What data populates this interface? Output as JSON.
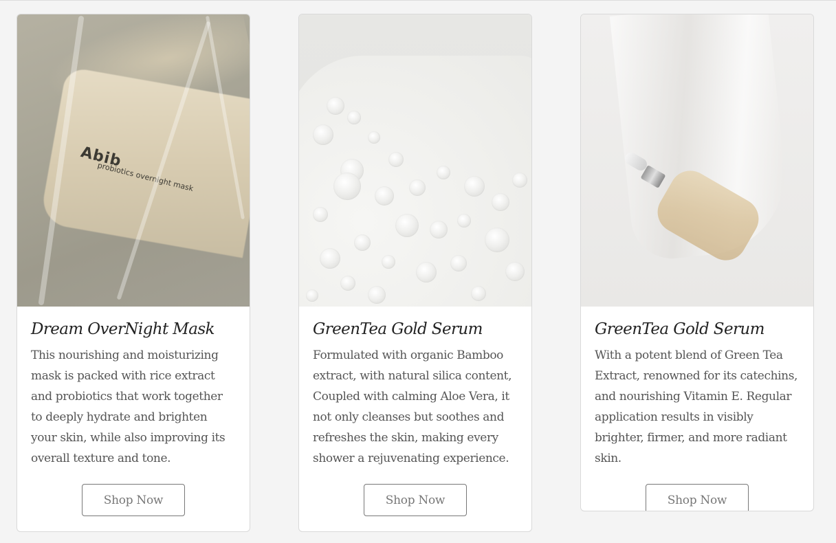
{
  "cards": [
    {
      "title": "Dream OverNight Mask",
      "description": "This nourishing and moisturizing mask is packed with rice extract and probiotics that work together to deeply hydrate and brighten your skin, while also improving its overall texture and tone.",
      "button_label": "Shop Now",
      "image": {
        "brand_text": "Abib",
        "sub_text": "probiotics overnight mask"
      }
    },
    {
      "title": "GreenTea Gold Serum",
      "description": "Formulated with organic Bamboo extract, with natural silica content, Coupled with calming Aloe Vera, it not only cleanses but soothes and refreshes the skin, making every shower a rejuvenating experience.",
      "button_label": "Shop Now"
    },
    {
      "title": "GreenTea Gold Serum",
      "description": "With a potent blend of Green Tea Extract, renowned for its catechins, and nourishing Vitamin E. Regular application results in visibly brighter, firmer, and more radiant skin.",
      "button_label": "Shop Now"
    }
  ]
}
